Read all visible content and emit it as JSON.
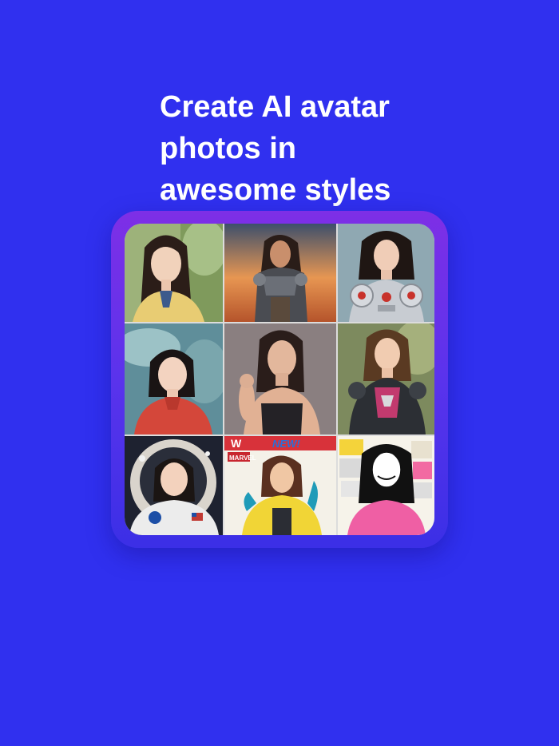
{
  "headline": {
    "line1": "Create AI avatar",
    "line2": "photos in",
    "line3": "awesome styles"
  },
  "gallery": {
    "comic_cover_text": "MARVEL",
    "comic_banner_text": "W",
    "colors": {
      "background": "#3030ef",
      "frame_top": "#7e2fe6",
      "frame_bottom": "#3b2fe6"
    }
  }
}
